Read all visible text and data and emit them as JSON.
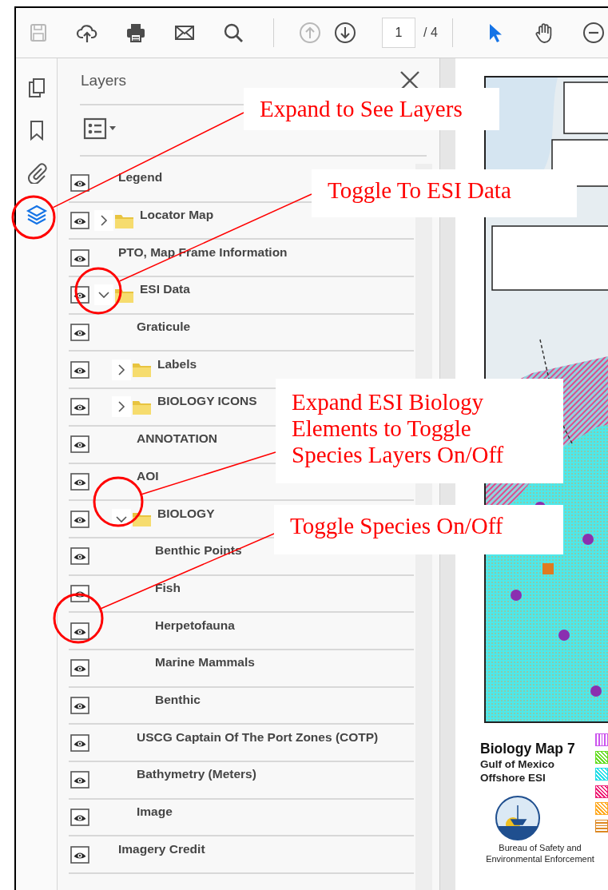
{
  "toolbar": {
    "buttons": [
      {
        "kind": "save",
        "disabled": true
      },
      {
        "kind": "upload",
        "disabled": false
      },
      {
        "kind": "print",
        "disabled": false
      },
      {
        "kind": "email",
        "disabled": false
      },
      {
        "kind": "search",
        "disabled": false
      }
    ],
    "page_nav": [
      {
        "kind": "previous",
        "disabled": true
      },
      {
        "kind": "next",
        "disabled": false
      }
    ],
    "page_field": {
      "value": "1"
    },
    "page_total": "/ 4",
    "tools": [
      {
        "kind": "select",
        "selected": true
      },
      {
        "kind": "hand",
        "selected": false
      },
      {
        "kind": "zoom-out",
        "selected": false
      }
    ]
  },
  "sidebar": {
    "items": [
      {
        "kind": "pages",
        "selected": false
      },
      {
        "kind": "bookmarks",
        "selected": false
      },
      {
        "kind": "attachments",
        "selected": false
      },
      {
        "kind": "layers",
        "selected": true
      }
    ]
  },
  "layers_panel": {
    "title": "Layers",
    "layers": [
      {
        "kind": "layer",
        "name": "Legend",
        "visible": true
      },
      {
        "kind": "folder",
        "name": "Locator Map",
        "visible": true,
        "expanded": false
      },
      {
        "kind": "layer",
        "name": "PTO, Map Frame Information",
        "visible": true
      },
      {
        "kind": "folder",
        "name": "ESI Data",
        "visible": true,
        "expanded": true,
        "children": [
          {
            "kind": "layer",
            "name": "Graticule",
            "visible": true
          },
          {
            "kind": "folder",
            "name": "Labels",
            "visible": true,
            "expanded": false
          },
          {
            "kind": "folder",
            "name": "BIOLOGY ICONS",
            "visible": true,
            "expanded": false
          },
          {
            "kind": "layer",
            "name": "ANNOTATION",
            "visible": true
          },
          {
            "kind": "layer",
            "name": "AOI",
            "visible": true
          },
          {
            "kind": "folder",
            "name": "BIOLOGY",
            "visible": true,
            "expanded": true,
            "children": [
              {
                "kind": "layer",
                "name": "Benthic Points",
                "visible": true
              },
              {
                "kind": "layer",
                "name": "Fish",
                "visible": true
              },
              {
                "kind": "layer",
                "name": "Herpetofauna",
                "visible": true
              },
              {
                "kind": "layer",
                "name": "Marine Mammals",
                "visible": true
              },
              {
                "kind": "layer",
                "name": "Benthic",
                "visible": true
              }
            ]
          },
          {
            "kind": "layer",
            "name": "USCG Captain Of The Port Zones (COTP)",
            "visible": true
          },
          {
            "kind": "layer",
            "name": "Bathymetry (Meters)",
            "visible": true
          },
          {
            "kind": "layer",
            "name": "Image",
            "visible": true
          }
        ]
      },
      {
        "kind": "layer",
        "name": "Imagery Credit",
        "visible": true
      }
    ]
  },
  "document": {
    "map": {
      "kind": "picture"
    },
    "title": "Biology Map 7",
    "subtitles": [
      "Gulf of Mexico",
      "Offshore ESI"
    ],
    "agency": "Bureau of Safety and Environmental Enforcement",
    "legend_swatches": [
      {
        "color": "#cc55ee",
        "kind": "vertical"
      },
      {
        "color": "#66dd22",
        "kind": "diagonal"
      },
      {
        "color": "#22dde8",
        "kind": "diagonal"
      },
      {
        "color": "#ee2277",
        "kind": "diagonal"
      },
      {
        "color": "#ffaa22",
        "kind": "diagonal"
      },
      {
        "color": "#dd8822",
        "kind": "horizontal"
      }
    ]
  },
  "annotations": [
    {
      "text": "Expand to See Layers"
    },
    {
      "text": "Toggle To ESI Data"
    },
    {
      "text": "Expand ESI Biology Elements to Toggle Species Layers On/Off"
    },
    {
      "text": "Toggle Species On/Off"
    }
  ]
}
